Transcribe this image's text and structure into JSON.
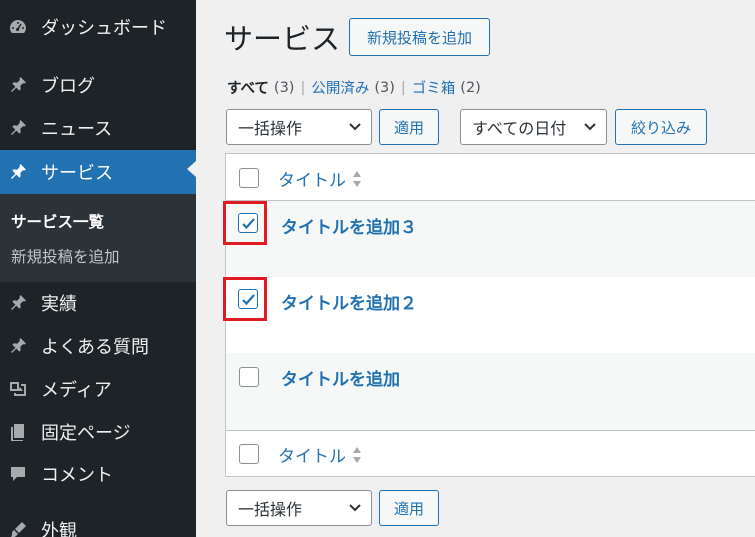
{
  "sidebar": {
    "items": [
      {
        "label": "ダッシュボード",
        "icon": "dashboard-icon"
      },
      {
        "label": "ブログ",
        "icon": "pin-icon"
      },
      {
        "label": "ニュース",
        "icon": "pin-icon"
      },
      {
        "label": "サービス",
        "icon": "pin-icon",
        "active": true
      },
      {
        "label": "実績",
        "icon": "pin-icon"
      },
      {
        "label": "よくある質問",
        "icon": "pin-icon"
      },
      {
        "label": "メディア",
        "icon": "media-icon"
      },
      {
        "label": "固定ページ",
        "icon": "page-icon"
      },
      {
        "label": "コメント",
        "icon": "comment-icon"
      },
      {
        "label": "外観",
        "icon": "appearance-icon"
      }
    ],
    "submenu": [
      {
        "label": "サービス一覧",
        "current": true
      },
      {
        "label": "新規投稿を追加",
        "current": false
      }
    ]
  },
  "header": {
    "title": "サービス",
    "add_new_label": "新規投稿を追加"
  },
  "filters": {
    "all_label": "すべて",
    "all_count": "(3)",
    "published_label": "公開済み",
    "published_count": "(3)",
    "trash_label": "ゴミ箱",
    "trash_count": "(2)",
    "separator": "|"
  },
  "tablenav_top": {
    "bulk_action": "一括操作",
    "apply_label": "適用",
    "date_filter": "すべての日付",
    "filter_label": "絞り込み"
  },
  "table": {
    "column_title": "タイトル",
    "rows": [
      {
        "title": "タイトルを追加３",
        "checked": true
      },
      {
        "title": "タイトルを追加２",
        "checked": true
      },
      {
        "title": "タイトルを追加",
        "checked": false
      }
    ]
  },
  "tablenav_bottom": {
    "bulk_action": "一括操作",
    "apply_label": "適用"
  },
  "colors": {
    "sidebar_bg": "#1d2327",
    "accent": "#2271b1",
    "highlight": "#e01b24"
  }
}
